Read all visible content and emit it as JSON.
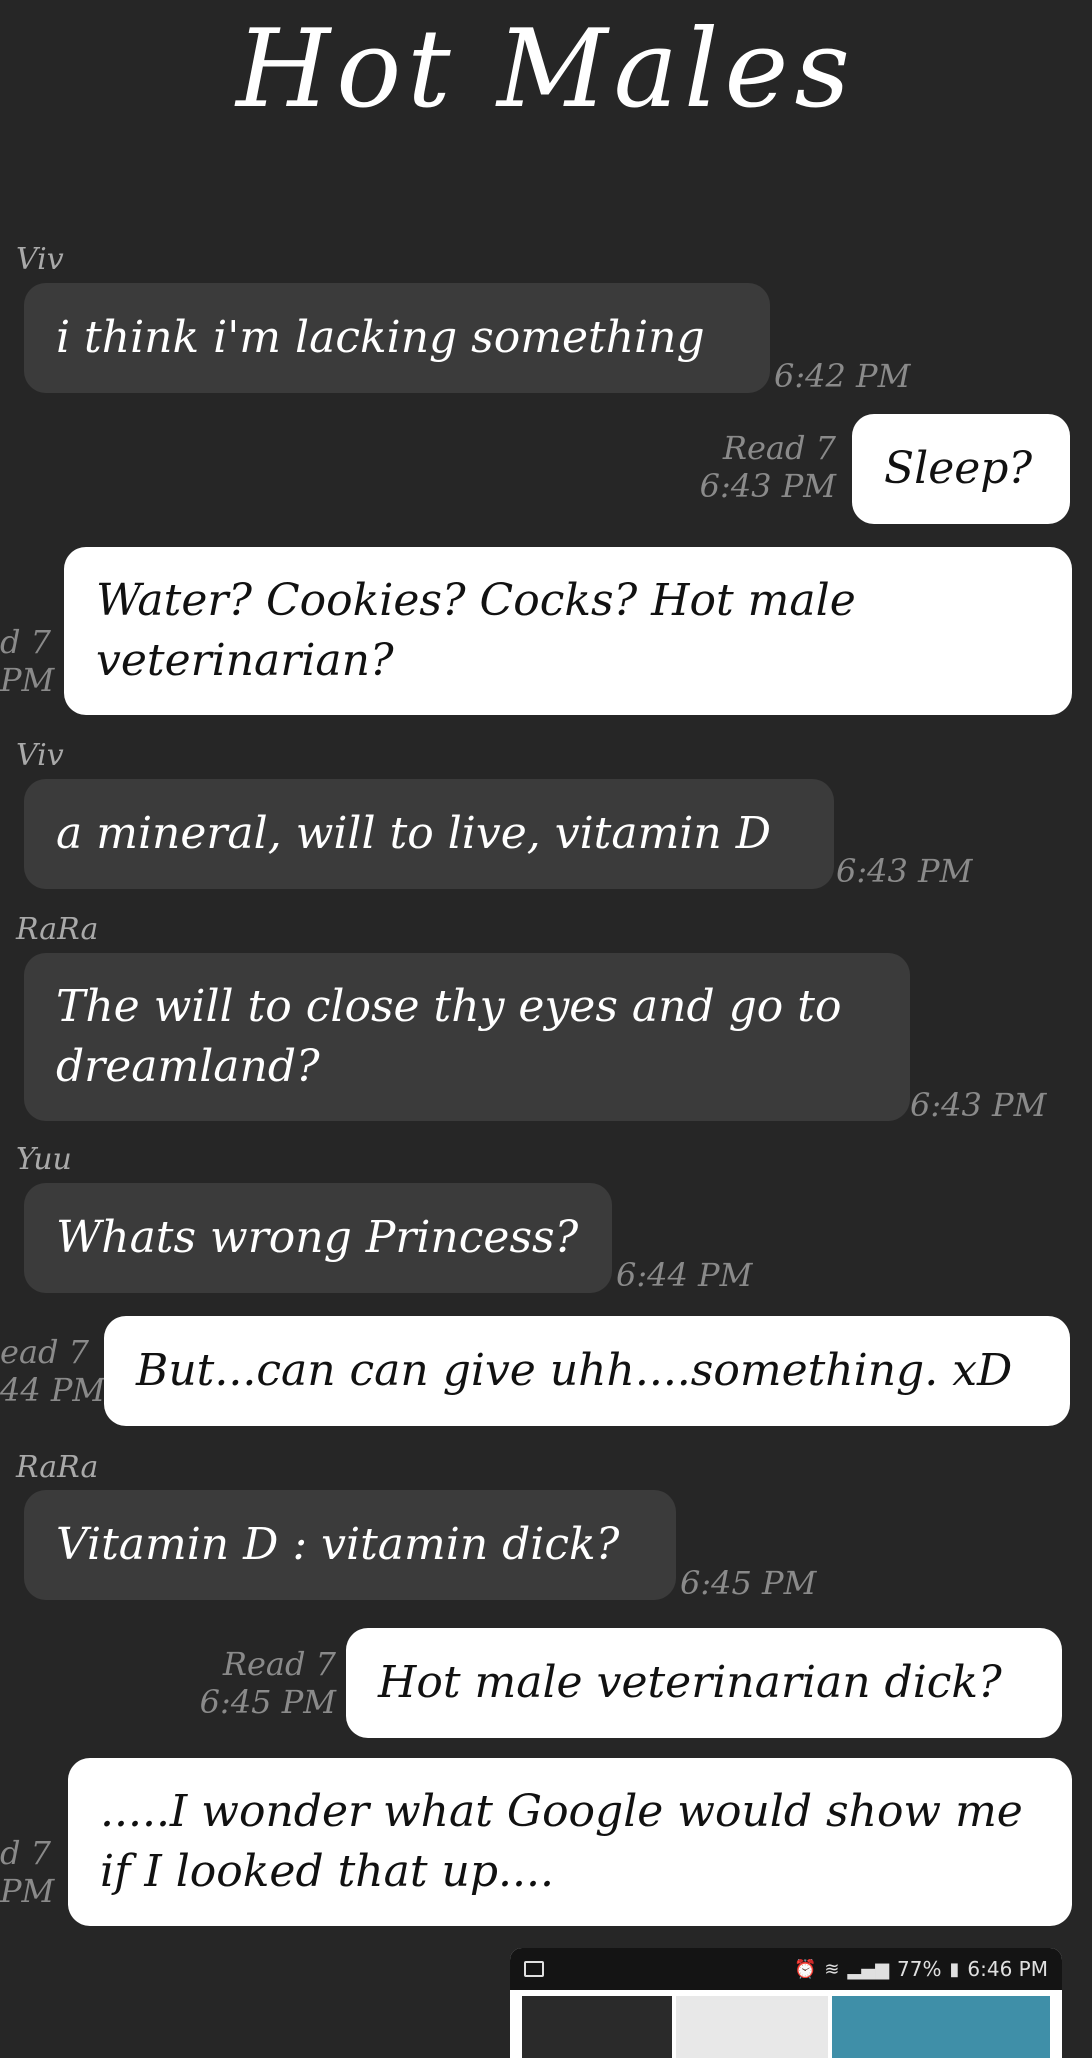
{
  "title": "Hot Males",
  "messages": [
    {
      "sender": "Viv",
      "text": "i think i'm lacking something",
      "time": "6:42 PM"
    },
    {
      "receipt": "Read 7",
      "time": "6:43 PM",
      "text": "Sleep?"
    },
    {
      "receipt_partial": "d 7",
      "time_partial": "PM",
      "text": "Water? Cookies? Cocks? Hot male veterinarian?"
    },
    {
      "sender": "Viv",
      "text": "a mineral, will to live, vitamin D",
      "time": "6:43 PM"
    },
    {
      "sender": "RaRa",
      "text": "The will to close thy eyes and go to dreamland?",
      "time": "6:43 PM"
    },
    {
      "sender": "Yuu",
      "text": "Whats wrong Princess?",
      "time": "6:44 PM"
    },
    {
      "receipt_partial": "ead 7",
      "time_partial": "44 PM",
      "text": "But...can can give uhh....something. xD"
    },
    {
      "sender": "RaRa",
      "text": "Vitamin D : vitamin dick?",
      "time": "6:45 PM"
    },
    {
      "receipt": "Read 7",
      "time": "6:45 PM",
      "text": "Hot male veterinarian dick?"
    },
    {
      "receipt_partial": "d 7",
      "time_partial": "PM",
      "text": ".....I wonder what Google would show me if I looked that up...."
    }
  ],
  "attachment": {
    "status_icons": [
      "alarm-icon",
      "wifi-icon",
      "signal-icon",
      "battery-icon"
    ],
    "battery": "77%",
    "clock": "6:46 PM",
    "colors": {
      "bar": "#141414",
      "thumb1": "#2a2a2a",
      "thumb2": "#e8e8e8",
      "thumb3": "#3f8fa8"
    }
  }
}
